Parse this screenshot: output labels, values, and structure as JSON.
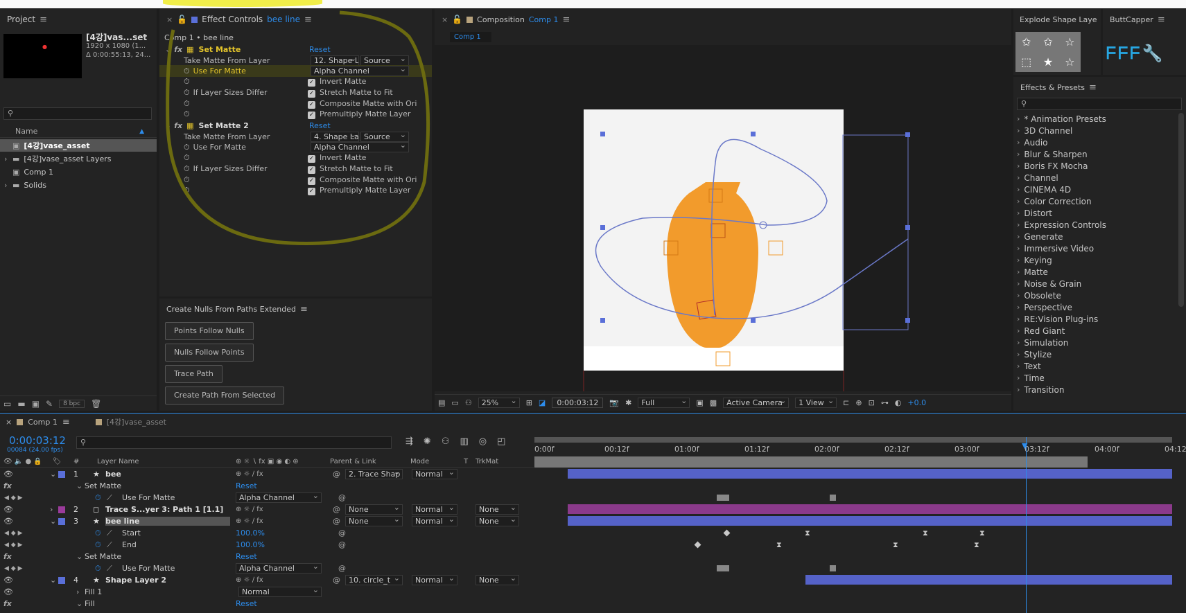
{
  "project": {
    "title": "Project",
    "thumb_name": "[4강]vas...set",
    "thumb_line1": "1920 x 1080 (1...",
    "thumb_line2": "Δ 0:00:55:13, 24...",
    "search_placeholder": "",
    "col_name": "Name",
    "items": [
      {
        "name": "[4강]vase_asset",
        "selected": true
      },
      {
        "name": "[4강]vase_asset Layers"
      },
      {
        "name": "Comp 1"
      },
      {
        "name": "Solids"
      }
    ],
    "bpc": "8 bpc"
  },
  "effect_controls": {
    "tab_prefix": "Effect Controls",
    "tab_layer": "bee line",
    "breadcrumb": "Comp 1 • bee line",
    "effects": [
      {
        "name": "Set Matte",
        "reset": "Reset",
        "take_label": "Take Matte From Layer",
        "take_value": "12. Shape L",
        "take_source": "Source",
        "use_label": "Use For Matte",
        "use_value": "Alpha Channel",
        "invert": "Invert Matte",
        "sizes_label": "If Layer Sizes Differ",
        "stretch": "Stretch Matte to Fit",
        "composite": "Composite Matte with Ori",
        "premultiply": "Premultiply Matte Layer"
      },
      {
        "name": "Set Matte 2",
        "reset": "Reset",
        "take_label": "Take Matte From Layer",
        "take_value": "4. Shape La",
        "take_source": "Source",
        "use_label": "Use For Matte",
        "use_value": "Alpha Channel",
        "invert": "Invert Matte",
        "sizes_label": "If Layer Sizes Differ",
        "stretch": "Stretch Matte to Fit",
        "composite": "Composite Matte with Ori",
        "premultiply": "Premultiply Matte Layer"
      }
    ]
  },
  "nulls": {
    "title": "Create Nulls From Paths Extended",
    "buttons": [
      "Points Follow Nulls",
      "Nulls Follow Points",
      "Trace Path",
      "Create Path From Selected"
    ]
  },
  "composition": {
    "tab_prefix": "Composition",
    "tab_comp": "Comp 1",
    "subtab": "Comp 1",
    "zoom": "25%",
    "time": "0:00:03:12",
    "quality": "Full",
    "camera": "Active Camera",
    "views": "1 View",
    "exposure": "+0.0"
  },
  "explode": {
    "title": "Explode Shape Laye"
  },
  "buttcapper": {
    "title": "ButtCapper"
  },
  "effects_presets": {
    "title": "Effects & Presets",
    "items": [
      "* Animation Presets",
      "3D Channel",
      "Audio",
      "Blur & Sharpen",
      "Boris FX Mocha",
      "Channel",
      "CINEMA 4D",
      "Color Correction",
      "Distort",
      "Expression Controls",
      "Generate",
      "Immersive Video",
      "Keying",
      "Matte",
      "Noise & Grain",
      "Obsolete",
      "Perspective",
      "RE:Vision Plug-ins",
      "Red Giant",
      "Simulation",
      "Stylize",
      "Text",
      "Time",
      "Transition"
    ]
  },
  "timeline": {
    "tab_comp": "Comp 1",
    "tab_asset": "[4강]vase_asset",
    "timecode": "0:00:03:12",
    "fps": "00084 (24.00 fps)",
    "col_num": "#",
    "col_layer": "Layer Name",
    "col_parent": "Parent & Link",
    "col_mode": "Mode",
    "col_t": "T",
    "col_trkmat": "TrkMat",
    "ruler": [
      "0:00f",
      "00:12f",
      "01:00f",
      "01:12f",
      "02:00f",
      "02:12f",
      "03:00f",
      "03:12f",
      "04:00f",
      "04:12"
    ],
    "rows": [
      {
        "kind": "layer",
        "num": "1",
        "name": "bee",
        "parent": "2. Trace Shap",
        "mode": "Normal",
        "trkmat": "",
        "color": "#5a6fd8"
      },
      {
        "kind": "group",
        "name": "Set Matte",
        "reset": "Reset"
      },
      {
        "kind": "prop",
        "name": "Use For Matte",
        "value": "Alpha Channel"
      },
      {
        "kind": "layer",
        "num": "2",
        "name": "Trace S...yer 3: Path 1 [1.1]",
        "parent": "None",
        "mode": "Normal",
        "trkmat": "None",
        "color": "#9b3b9b"
      },
      {
        "kind": "layer",
        "num": "3",
        "name": "bee line",
        "parent": "None",
        "mode": "Normal",
        "trkmat": "None",
        "color": "#5a6fd8",
        "selected": true
      },
      {
        "kind": "prop",
        "name": "Start",
        "value": "100.0%"
      },
      {
        "kind": "prop",
        "name": "End",
        "value": "100.0%"
      },
      {
        "kind": "group",
        "name": "Set Matte",
        "reset": "Reset"
      },
      {
        "kind": "prop",
        "name": "Use For Matte",
        "value": "Alpha Channel"
      },
      {
        "kind": "layer",
        "num": "4",
        "name": "Shape Layer 2",
        "parent": "10. circle_t",
        "mode": "Normal",
        "trkmat": "None",
        "color": "#5a6fd8"
      },
      {
        "kind": "sub",
        "name": "Fill 1",
        "value": "Normal"
      },
      {
        "kind": "group",
        "name": "Fill",
        "reset": "Reset"
      }
    ]
  }
}
